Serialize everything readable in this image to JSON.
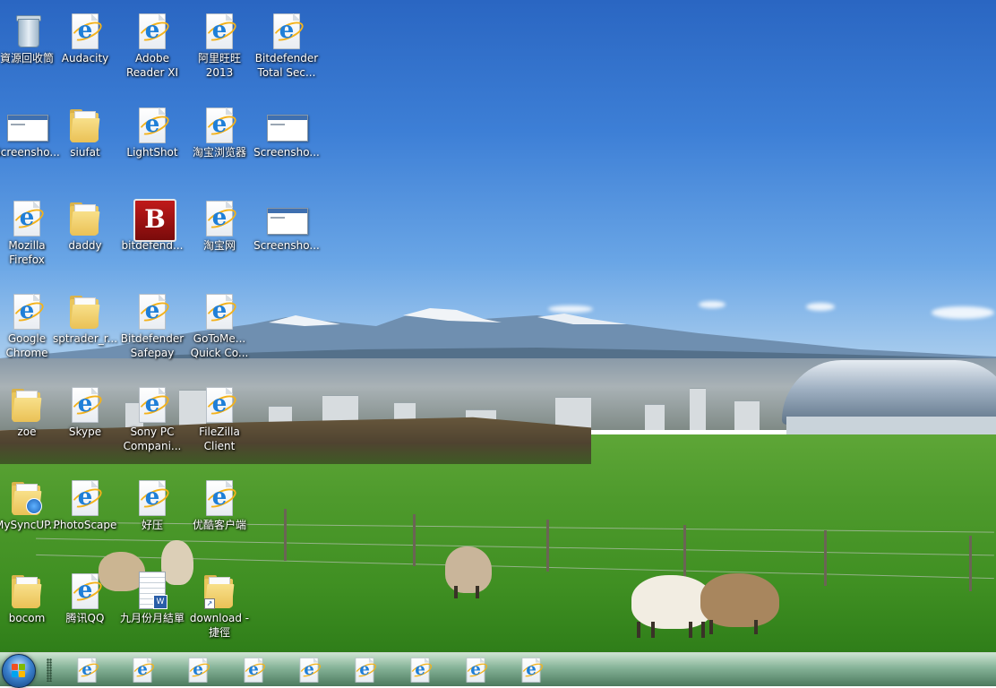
{
  "desktop": {
    "icons": [
      {
        "id": "recycle-bin",
        "label": "資源回收筒",
        "type": "recycle-bin-icon"
      },
      {
        "id": "audacity",
        "label": "Audacity",
        "type": "ie-file-icon"
      },
      {
        "id": "adobe-reader",
        "label": "Adobe Reader XI",
        "type": "ie-file-icon"
      },
      {
        "id": "aliwangwang",
        "label": "阿里旺旺 2013",
        "type": "ie-file-icon"
      },
      {
        "id": "bitdefender-total",
        "label": "Bitdefender Total Sec...",
        "type": "ie-file-icon"
      },
      {
        "id": "screenshot-1",
        "label": "Screensho...",
        "type": "screenshot-thumbnail-icon"
      },
      {
        "id": "siufat",
        "label": "siufat",
        "type": "folder-icon"
      },
      {
        "id": "lightshot",
        "label": "LightShot",
        "type": "ie-file-icon"
      },
      {
        "id": "taobao-browser",
        "label": "淘宝浏览器",
        "type": "ie-file-icon"
      },
      {
        "id": "screenshot-2",
        "label": "Screensho...",
        "type": "screenshot-thumbnail-icon"
      },
      {
        "id": "mozilla-firefox",
        "label": "Mozilla Firefox",
        "type": "ie-file-icon"
      },
      {
        "id": "daddy",
        "label": "daddy",
        "type": "folder-icon"
      },
      {
        "id": "bitdefend",
        "label": "bitdefend...",
        "type": "bitdefender-app-icon"
      },
      {
        "id": "taobao",
        "label": "淘宝网",
        "type": "ie-file-icon"
      },
      {
        "id": "screenshot-3",
        "label": "Screensho...",
        "type": "screenshot-thumbnail-icon"
      },
      {
        "id": "google-chrome",
        "label": "Google Chrome",
        "type": "ie-file-icon"
      },
      {
        "id": "sptrader",
        "label": "sptrader_r...",
        "type": "folder-icon"
      },
      {
        "id": "bitdefender-safepay",
        "label": "Bitdefender Safepay",
        "type": "ie-file-icon"
      },
      {
        "id": "gotomeeting",
        "label": "GoToMe... Quick Co...",
        "type": "ie-file-icon"
      },
      {
        "id": "zoe",
        "label": "zoe",
        "type": "folder-icon"
      },
      {
        "id": "skype",
        "label": "Skype",
        "type": "ie-file-icon"
      },
      {
        "id": "sony-pc",
        "label": "Sony PC Compani...",
        "type": "ie-file-icon"
      },
      {
        "id": "filezilla",
        "label": "FileZilla Client",
        "type": "ie-file-icon"
      },
      {
        "id": "mysyncup",
        "label": "MySyncUP...",
        "type": "sync-folder-icon"
      },
      {
        "id": "photoscape",
        "label": "PhotoScape",
        "type": "ie-file-icon"
      },
      {
        "id": "haoya",
        "label": "好压",
        "type": "ie-file-icon"
      },
      {
        "id": "youku",
        "label": "优酷客户端",
        "type": "ie-file-icon"
      },
      {
        "id": "bocom",
        "label": "bocom",
        "type": "folder-icon"
      },
      {
        "id": "tencent-qq",
        "label": "腾讯QQ",
        "type": "ie-file-icon"
      },
      {
        "id": "september-report",
        "label": "九月份月結單",
        "type": "word-document-icon"
      },
      {
        "id": "download-shortcut",
        "label": "download - 捷徑",
        "type": "folder-shortcut-icon"
      }
    ]
  },
  "taskbar": {
    "start_button": "windows-start-orb-icon",
    "pinned": [
      {
        "id": "pin-1",
        "icon": "ie-file-icon"
      },
      {
        "id": "pin-2",
        "icon": "ie-file-icon"
      },
      {
        "id": "pin-3",
        "icon": "ie-file-icon"
      },
      {
        "id": "pin-4",
        "icon": "ie-file-icon"
      },
      {
        "id": "pin-5",
        "icon": "ie-file-icon"
      },
      {
        "id": "pin-6",
        "icon": "ie-file-icon"
      },
      {
        "id": "pin-7",
        "icon": "ie-file-icon"
      },
      {
        "id": "pin-8",
        "icon": "ie-file-icon"
      },
      {
        "id": "pin-9",
        "icon": "ie-file-icon"
      }
    ]
  },
  "colors": {
    "sky": "#3d7fd6",
    "grass": "#4e9a2c",
    "taskbar": "#78aa8c",
    "label_text": "#ffffff",
    "ie_blue": "#1f7fd8",
    "ie_ring": "#f3b21b",
    "folder": "#eac156",
    "bitdefender_red": "#c01a1a"
  }
}
